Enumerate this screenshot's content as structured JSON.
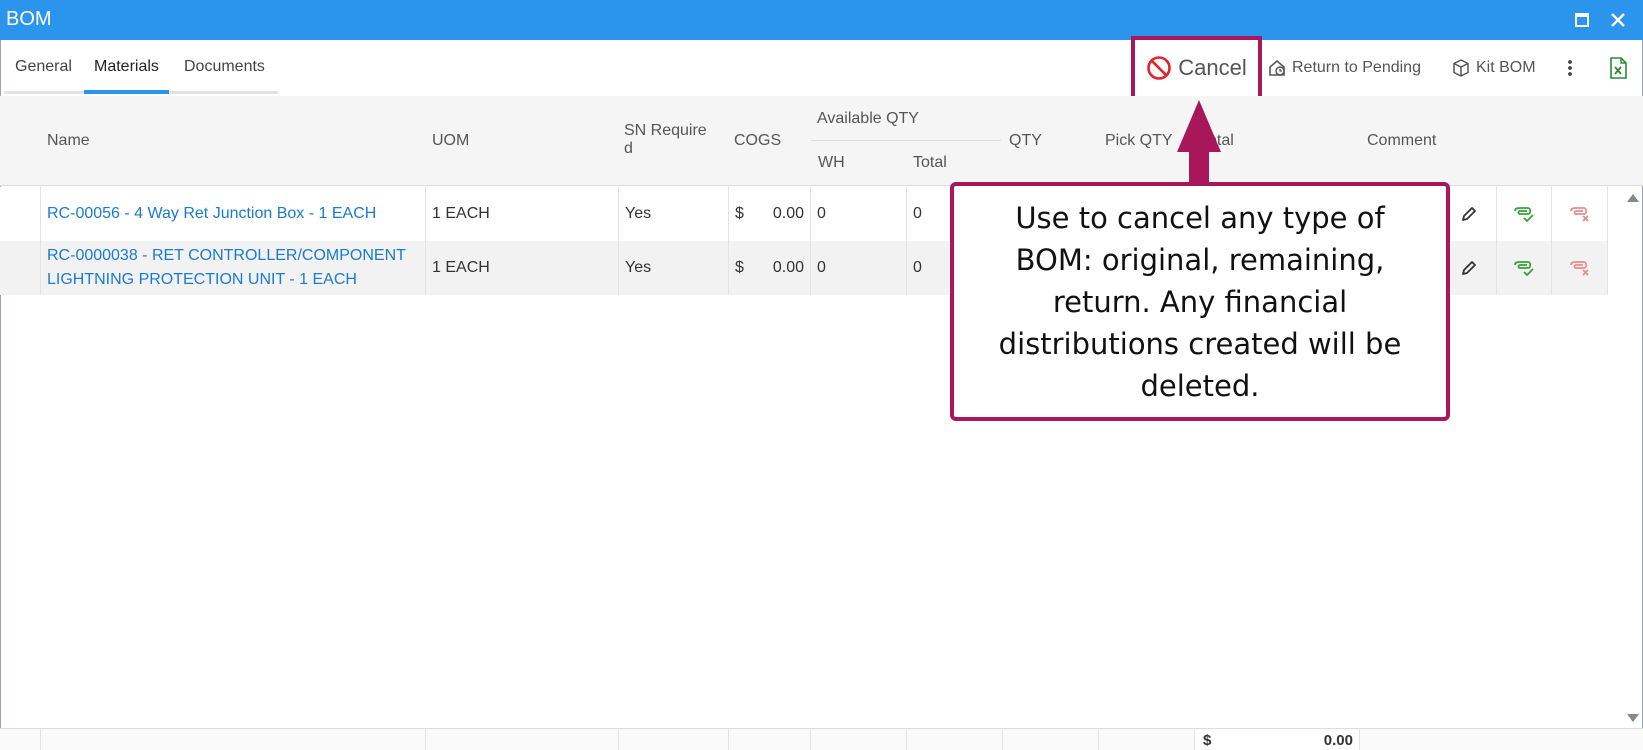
{
  "window": {
    "title": "BOM"
  },
  "tabs": [
    {
      "label": "General"
    },
    {
      "label": "Materials"
    },
    {
      "label": "Documents"
    }
  ],
  "toolbar": {
    "cancel_label": "Cancel",
    "return_label": "Return to Pending",
    "kit_label": "Kit BOM"
  },
  "grid": {
    "headers": {
      "name": "Name",
      "uom": "UOM",
      "sn_line1": "SN Require",
      "sn_line2": "d",
      "cogs": "COGS",
      "available_qty": "Available QTY",
      "wh": "WH",
      "total_avail": "Total",
      "qty": "QTY",
      "pick_qty": "Pick QTY",
      "total": "Total",
      "comment": "Comment"
    },
    "rows": [
      {
        "name": "RC-00056 - 4 Way Ret Junction Box - 1 EACH",
        "uom": "1 EACH",
        "sn": "Yes",
        "cogs_currency": "$",
        "cogs_value": "0.00",
        "wh": "0",
        "total": "0"
      },
      {
        "name": "RC-0000038 - RET CONTROLLER/COMPONENT LIGHTNING PROTECTION UNIT - 1 EACH",
        "uom": "1 EACH",
        "sn": "Yes",
        "cogs_currency": "$",
        "cogs_value": "0.00",
        "wh": "0",
        "total": "0"
      }
    ],
    "footer": {
      "currency": "$",
      "total": "0.00"
    }
  },
  "callout": {
    "text": "Use to cancel any type of BOM: original, remaining, return. Any financial distributions created will be deleted."
  },
  "colors": {
    "accent": "#2b95ee",
    "highlight": "#a8175a",
    "link": "#1a7bd0",
    "approve": "#3aa03a",
    "reject": "#e88c8c"
  },
  "icons": [
    "maximize-icon",
    "close-icon",
    "no-entry-icon",
    "return-pending-icon",
    "box-icon",
    "more-vert-icon",
    "excel-icon",
    "edit-icon",
    "approve-icon",
    "reject-icon"
  ]
}
